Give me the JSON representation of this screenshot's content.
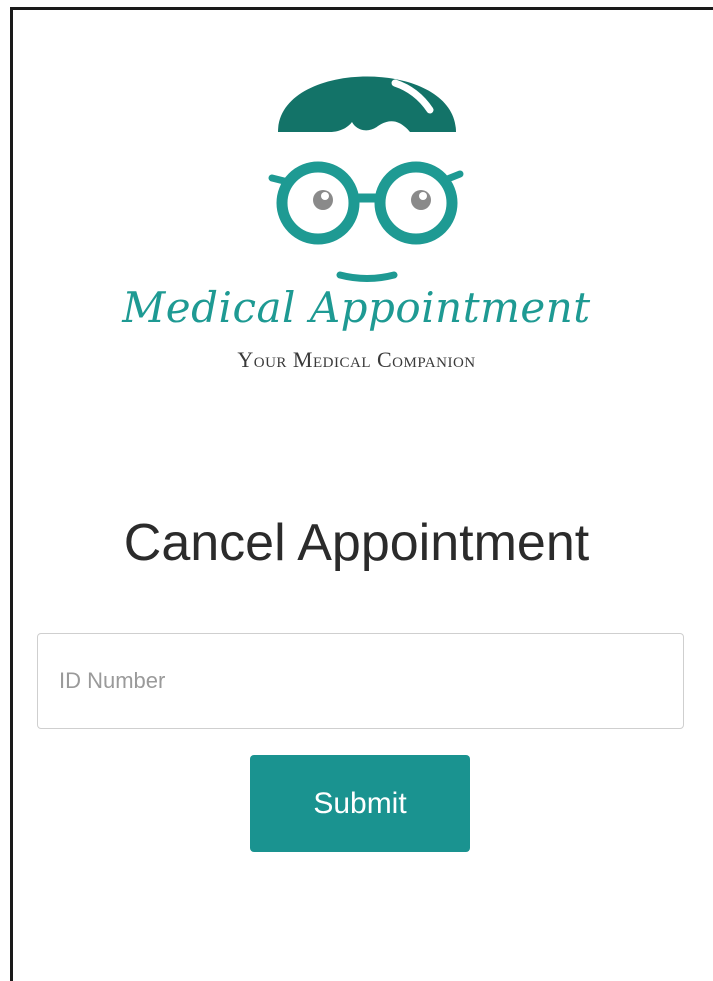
{
  "brand": {
    "name": "Medical Appointment",
    "tagline": "Your Medical Companion",
    "logo_icon": "doctor-glasses-logo",
    "color": "#1e9a93"
  },
  "page": {
    "title": "Cancel Appointment"
  },
  "form": {
    "id_input": {
      "placeholder": "ID Number",
      "value": ""
    },
    "submit_label": "Submit"
  },
  "colors": {
    "accent": "#1a9390",
    "logo_dark": "#137368",
    "logo_teal": "#1e9a93"
  }
}
